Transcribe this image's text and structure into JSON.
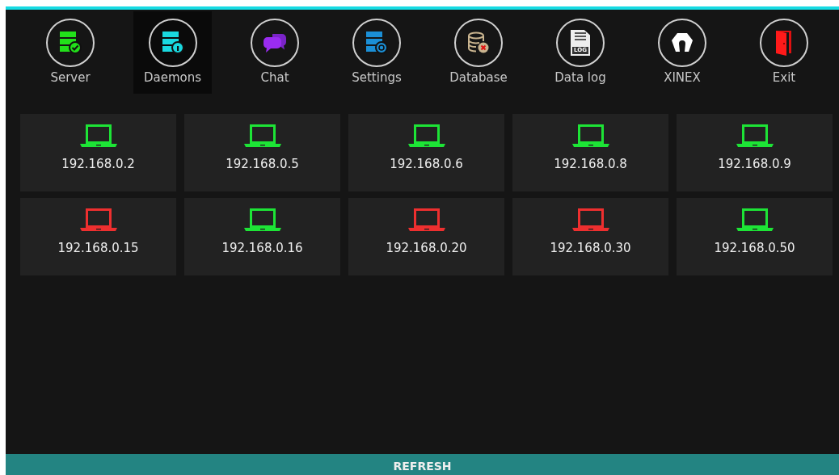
{
  "nav": [
    {
      "label": "Server",
      "kind": "server",
      "selected": false
    },
    {
      "label": "Daemons",
      "kind": "daemons",
      "selected": true
    },
    {
      "label": "Chat",
      "kind": "chat",
      "selected": false
    },
    {
      "label": "Settings",
      "kind": "settings",
      "selected": false
    },
    {
      "label": "Database",
      "kind": "database",
      "selected": false
    },
    {
      "label": "Data log",
      "kind": "datalog",
      "selected": false,
      "icon_text": "LOG"
    },
    {
      "label": "XINEX",
      "kind": "xinex",
      "selected": false
    },
    {
      "label": "Exit",
      "kind": "exit",
      "selected": false
    }
  ],
  "devices": [
    {
      "ip": "192.168.0.2",
      "online": true
    },
    {
      "ip": "192.168.0.5",
      "online": true
    },
    {
      "ip": "192.168.0.6",
      "online": true
    },
    {
      "ip": "192.168.0.8",
      "online": true
    },
    {
      "ip": "192.168.0.9",
      "online": true
    },
    {
      "ip": "192.168.0.15",
      "online": false
    },
    {
      "ip": "192.168.0.16",
      "online": true
    },
    {
      "ip": "192.168.0.20",
      "online": false
    },
    {
      "ip": "192.168.0.30",
      "online": false
    },
    {
      "ip": "192.168.0.50",
      "online": true
    }
  ],
  "refresh": "REFRESH"
}
